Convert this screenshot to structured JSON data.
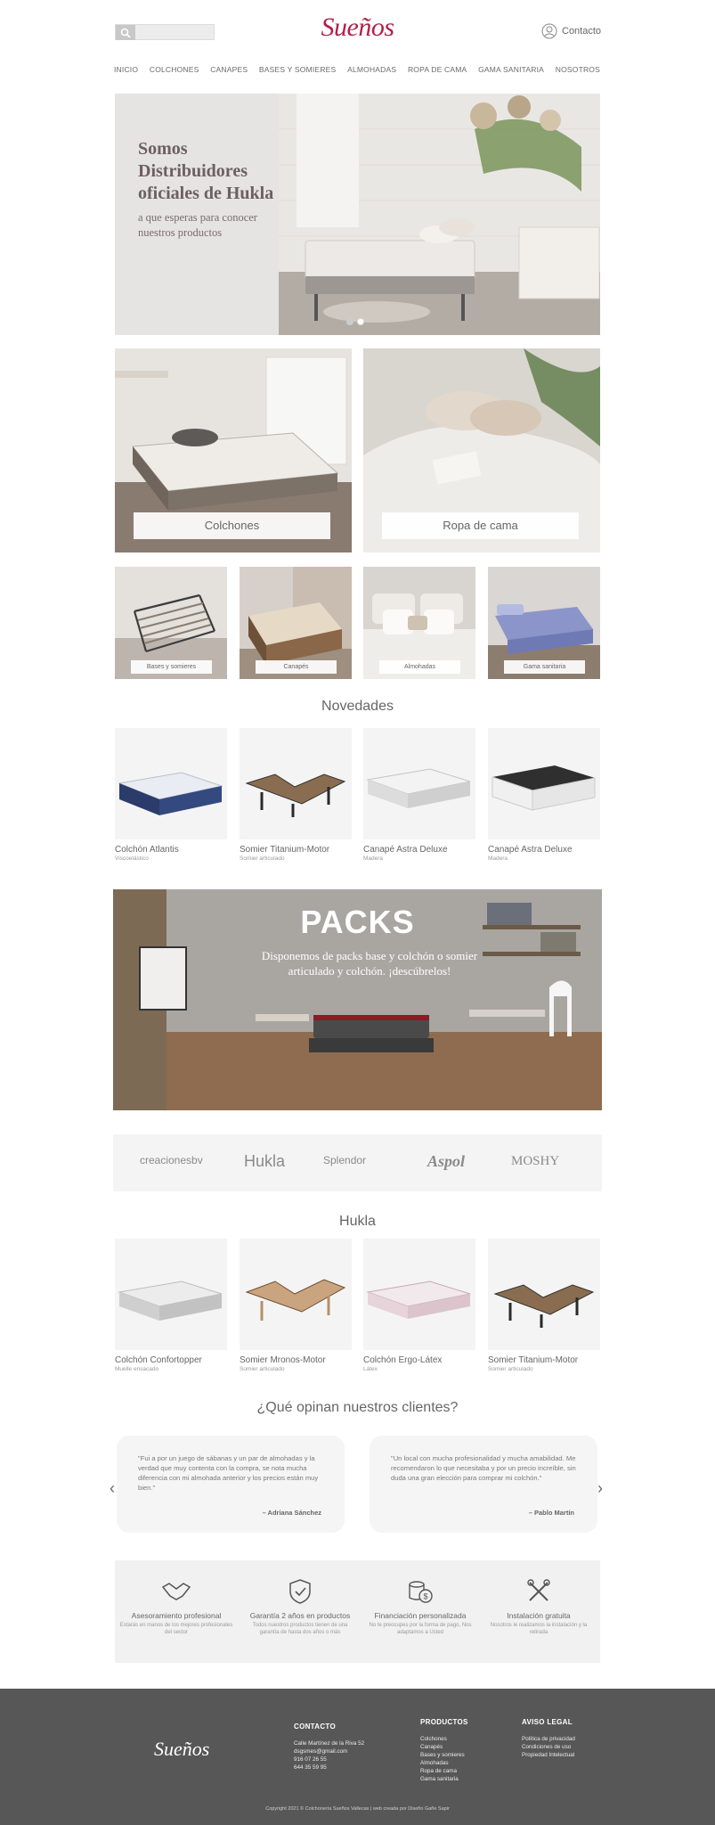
{
  "header": {
    "search_placeholder": "",
    "logo": "Sueños",
    "contact_label": "Contacto",
    "brand_color": "#b0214a"
  },
  "nav": [
    "INICIO",
    "COLCHONES",
    "CANAPES",
    "BASES Y SOMIERES",
    "ALMOHADAS",
    "ROPA DE CAMA",
    "GAMA SANITARIA",
    "NOSOTROS"
  ],
  "hero": {
    "title": "Somos Distribuidores oficiales de Hukla",
    "subtitle": "a que esperas para conocer  nuestros productos",
    "slides": 2,
    "active_slide": 2
  },
  "categories_big": [
    "Colchones",
    "Ropa de cama"
  ],
  "categories_small": [
    "Bases y somieres",
    "Canapés",
    "Almohadas",
    "Gama sanitaria"
  ],
  "novedades": {
    "title": "Novedades",
    "items": [
      {
        "name": "Colchón Atlantis",
        "sub": "Viscoelástico"
      },
      {
        "name": "Somier Titanium-Motor",
        "sub": "Somier articulado"
      },
      {
        "name": "Canapé Astra Deluxe",
        "sub": "Madera"
      },
      {
        "name": "Canapé Astra Deluxe",
        "sub": "Madera"
      }
    ]
  },
  "packs": {
    "title": "PACKS",
    "text": "Disponemos de packs base y colchón o somier articulado y colchón. ¡descúbrelos!"
  },
  "brands": [
    "creacionesbv",
    "Hukla",
    "Splendor",
    "Aspol",
    "MOSHY"
  ],
  "hukla": {
    "title": "Hukla",
    "items": [
      {
        "name": "Colchón Confortopper",
        "sub": "Muelle ensacado"
      },
      {
        "name": "Somier Mronos-Motor",
        "sub": "Somier articulado"
      },
      {
        "name": "Colchón Ergo-Látex",
        "sub": "Látex"
      },
      {
        "name": "Somier Titanium-Motor",
        "sub": "Somier articulado"
      }
    ]
  },
  "reviews": {
    "title": "¿Qué opinan nuestros clientes?",
    "items": [
      {
        "quote": "\"Fui a por un juego de sábanas y un par de almohadas y la verdad que muy contenta con la compra, se nota mucha diferencia con mi almohada anterior y los precios están muy bien.\"",
        "author": "– Adriana Sánchez"
      },
      {
        "quote": "\"Un local con mucha profesionalidad y mucha amabilidad. Me recomendaron lo que necesitaba y por un precio increíble, sin duda una gran elección para comprar mi colchón.\"",
        "author": "– Pablo Martín"
      }
    ]
  },
  "features": [
    {
      "icon": "handshake-icon",
      "title": "Asesoramiento profesional",
      "desc": "Estarás en manos de los mejores profesionales del sector"
    },
    {
      "icon": "shield-check-icon",
      "title": "Garantía 2 años en productos",
      "desc": "Todos nuestros productos tienen de una garantía de hasta dos años o más"
    },
    {
      "icon": "money-icon",
      "title": "Financiación personalizada",
      "desc": "No te preocupes por la forma de pago, Nos adaptamos a Usted"
    },
    {
      "icon": "tools-icon",
      "title": "Instalación gratuita",
      "desc": "Nosotros le realizamos la instalación y la retirada"
    }
  ],
  "footer": {
    "logo": "Sueños",
    "contact": {
      "title": "CONTACTO",
      "lines": [
        "Calle Martínez de la Riva 52",
        "dsgsmes@gmail.com",
        "916 07 26 55",
        "644 35 59 95"
      ]
    },
    "products": {
      "title": "PRODUCTOS",
      "lines": [
        "Colchones",
        "Canapés",
        "Bases y somieres",
        "Almohadas",
        "Ropa de cama",
        "Gama sanitaria"
      ]
    },
    "legal": {
      "title": "AVISO LEGAL",
      "lines": [
        "Política de privacidad",
        "Condiciones de uso",
        "Propiedad Intelectual"
      ]
    },
    "copyright": "Copyright 2021 © Colchonería Sueños Vallecas | web creada por Diseño Gañe Sapir"
  }
}
